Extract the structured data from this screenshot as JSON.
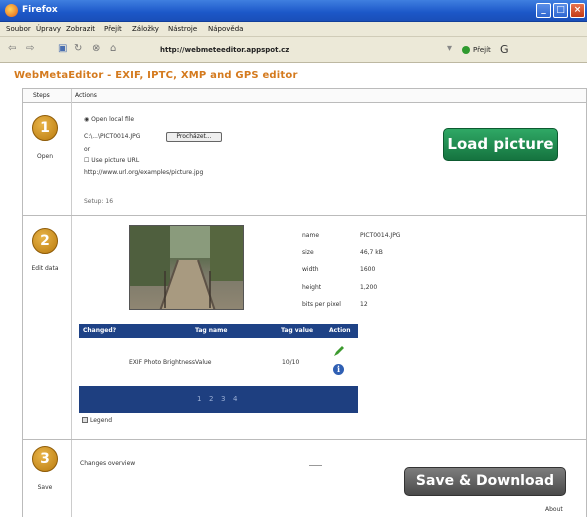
{
  "window": {
    "title": "Firefox",
    "min_glyph": "_",
    "max_glyph": "□",
    "close_glyph": "×"
  },
  "menu": [
    "Soubor",
    "Úpravy",
    "Zobrazit",
    "Přejít",
    "Záložky",
    "Nástroje",
    "Nápověda"
  ],
  "nav": {
    "back": "⇦",
    "forward": "⇨",
    "url": "http://webmeteeditor.appspot.cz",
    "go_label": "Přejít"
  },
  "page": {
    "title": "WebMetaEditor - EXIF, IPTC, XMP and GPS editor",
    "header": {
      "steps": "Steps",
      "actions": "Actions"
    }
  },
  "step1": {
    "number": "1",
    "label": "Open",
    "open_local": "Open local file",
    "filename": "C:\\...\\PICT0014.JPG",
    "browse": "Procházet...",
    "or": "or",
    "use_url": "Use picture URL",
    "url_value": "http://www.url.org/examples/picture.jpg",
    "note": "Setup: 16",
    "load_button": "Load picture"
  },
  "step2": {
    "number": "2",
    "label": "Edit data",
    "meta": [
      {
        "key": "name",
        "value": "PICT0014.JPG"
      },
      {
        "key": "size",
        "value": "46,7 kB"
      },
      {
        "key": "width",
        "value": "1600"
      },
      {
        "key": "height",
        "value": "1,200"
      },
      {
        "key": "bits per pixel",
        "value": "12"
      }
    ],
    "table": {
      "headers": {
        "changed": "Changed?",
        "tag_name": "Tag name",
        "tag_value": "Tag value",
        "action": "Action"
      },
      "row": {
        "tag_name": "EXIF Photo BrightnessValue",
        "tag_value": "10/10"
      }
    },
    "pager": [
      "1",
      "2",
      "3",
      "4"
    ],
    "legend": "Legend"
  },
  "step3": {
    "number": "3",
    "label": "Save",
    "changes_text": "Changes overview",
    "save_button": "Save & Download",
    "footer_link": "About"
  }
}
